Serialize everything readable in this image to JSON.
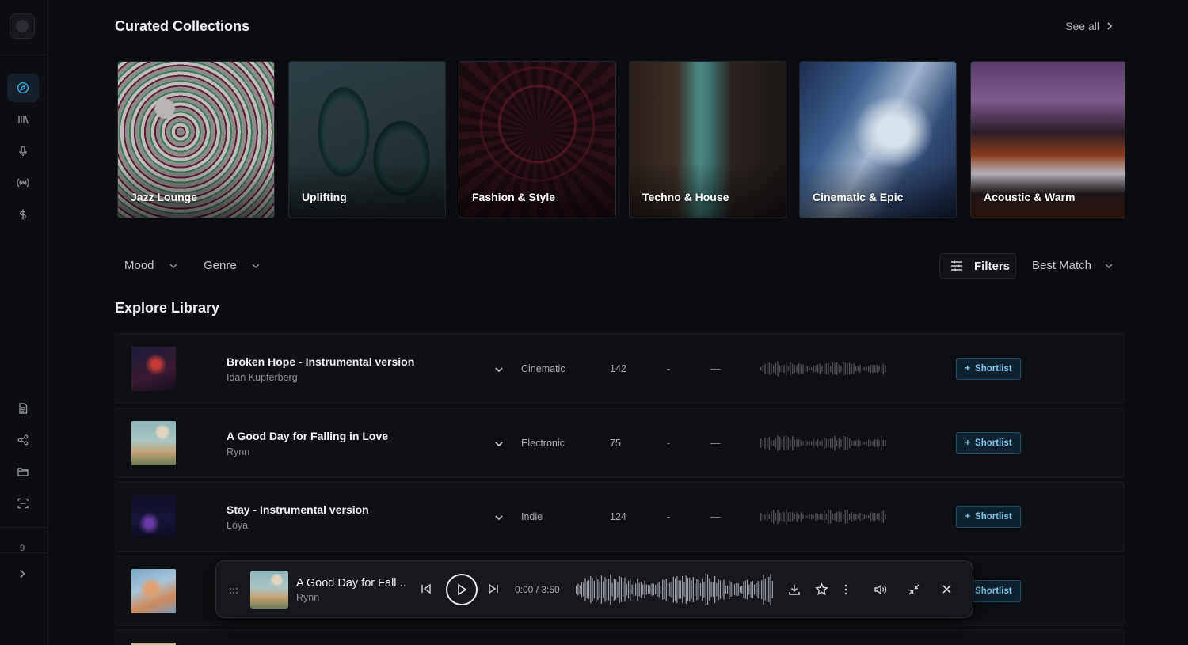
{
  "sidebar": {
    "nav": [
      {
        "name": "compass-icon",
        "active": true
      },
      {
        "name": "library-icon",
        "active": false
      },
      {
        "name": "microphone-icon",
        "active": false
      },
      {
        "name": "broadcast-icon",
        "active": false
      },
      {
        "name": "dollar-icon",
        "active": false
      }
    ],
    "tools": [
      "document-icon",
      "share-icon",
      "folder-icon",
      "scan-icon"
    ],
    "count": "9",
    "expand_icon": "chevron-right-icon"
  },
  "collections": {
    "title": "Curated Collections",
    "see_all": "See all",
    "items": [
      {
        "label": "Jazz Lounge"
      },
      {
        "label": "Uplifting"
      },
      {
        "label": "Fashion & Style"
      },
      {
        "label": "Techno & House"
      },
      {
        "label": "Cinematic & Epic"
      },
      {
        "label": "Acoustic & Warm"
      }
    ]
  },
  "filters": {
    "mood": "Mood",
    "genre": "Genre",
    "filters_label": "Filters",
    "sort": "Best Match"
  },
  "library": {
    "title": "Explore Library",
    "shortlist_label": "Shortlist",
    "tracks": [
      {
        "title": "Broken Hope - Instrumental version",
        "artist": "Idan Kupferberg",
        "genre": "Cinematic",
        "bpm": "142",
        "key": "-",
        "duration": "—"
      },
      {
        "title": "A Good Day for Falling in Love",
        "artist": "Rynn",
        "genre": "Electronic",
        "bpm": "75",
        "key": "-",
        "duration": "—"
      },
      {
        "title": "Stay - Instrumental version",
        "artist": "Loya",
        "genre": "Indie",
        "bpm": "124",
        "key": "-",
        "duration": "—"
      }
    ]
  },
  "player": {
    "title": "A Good Day for Fall...",
    "artist": "Rynn",
    "time": "0:00 / 3:50",
    "progress": 0
  },
  "colors": {
    "accent": "#3aa9e0",
    "background": "#0b0c0f"
  }
}
